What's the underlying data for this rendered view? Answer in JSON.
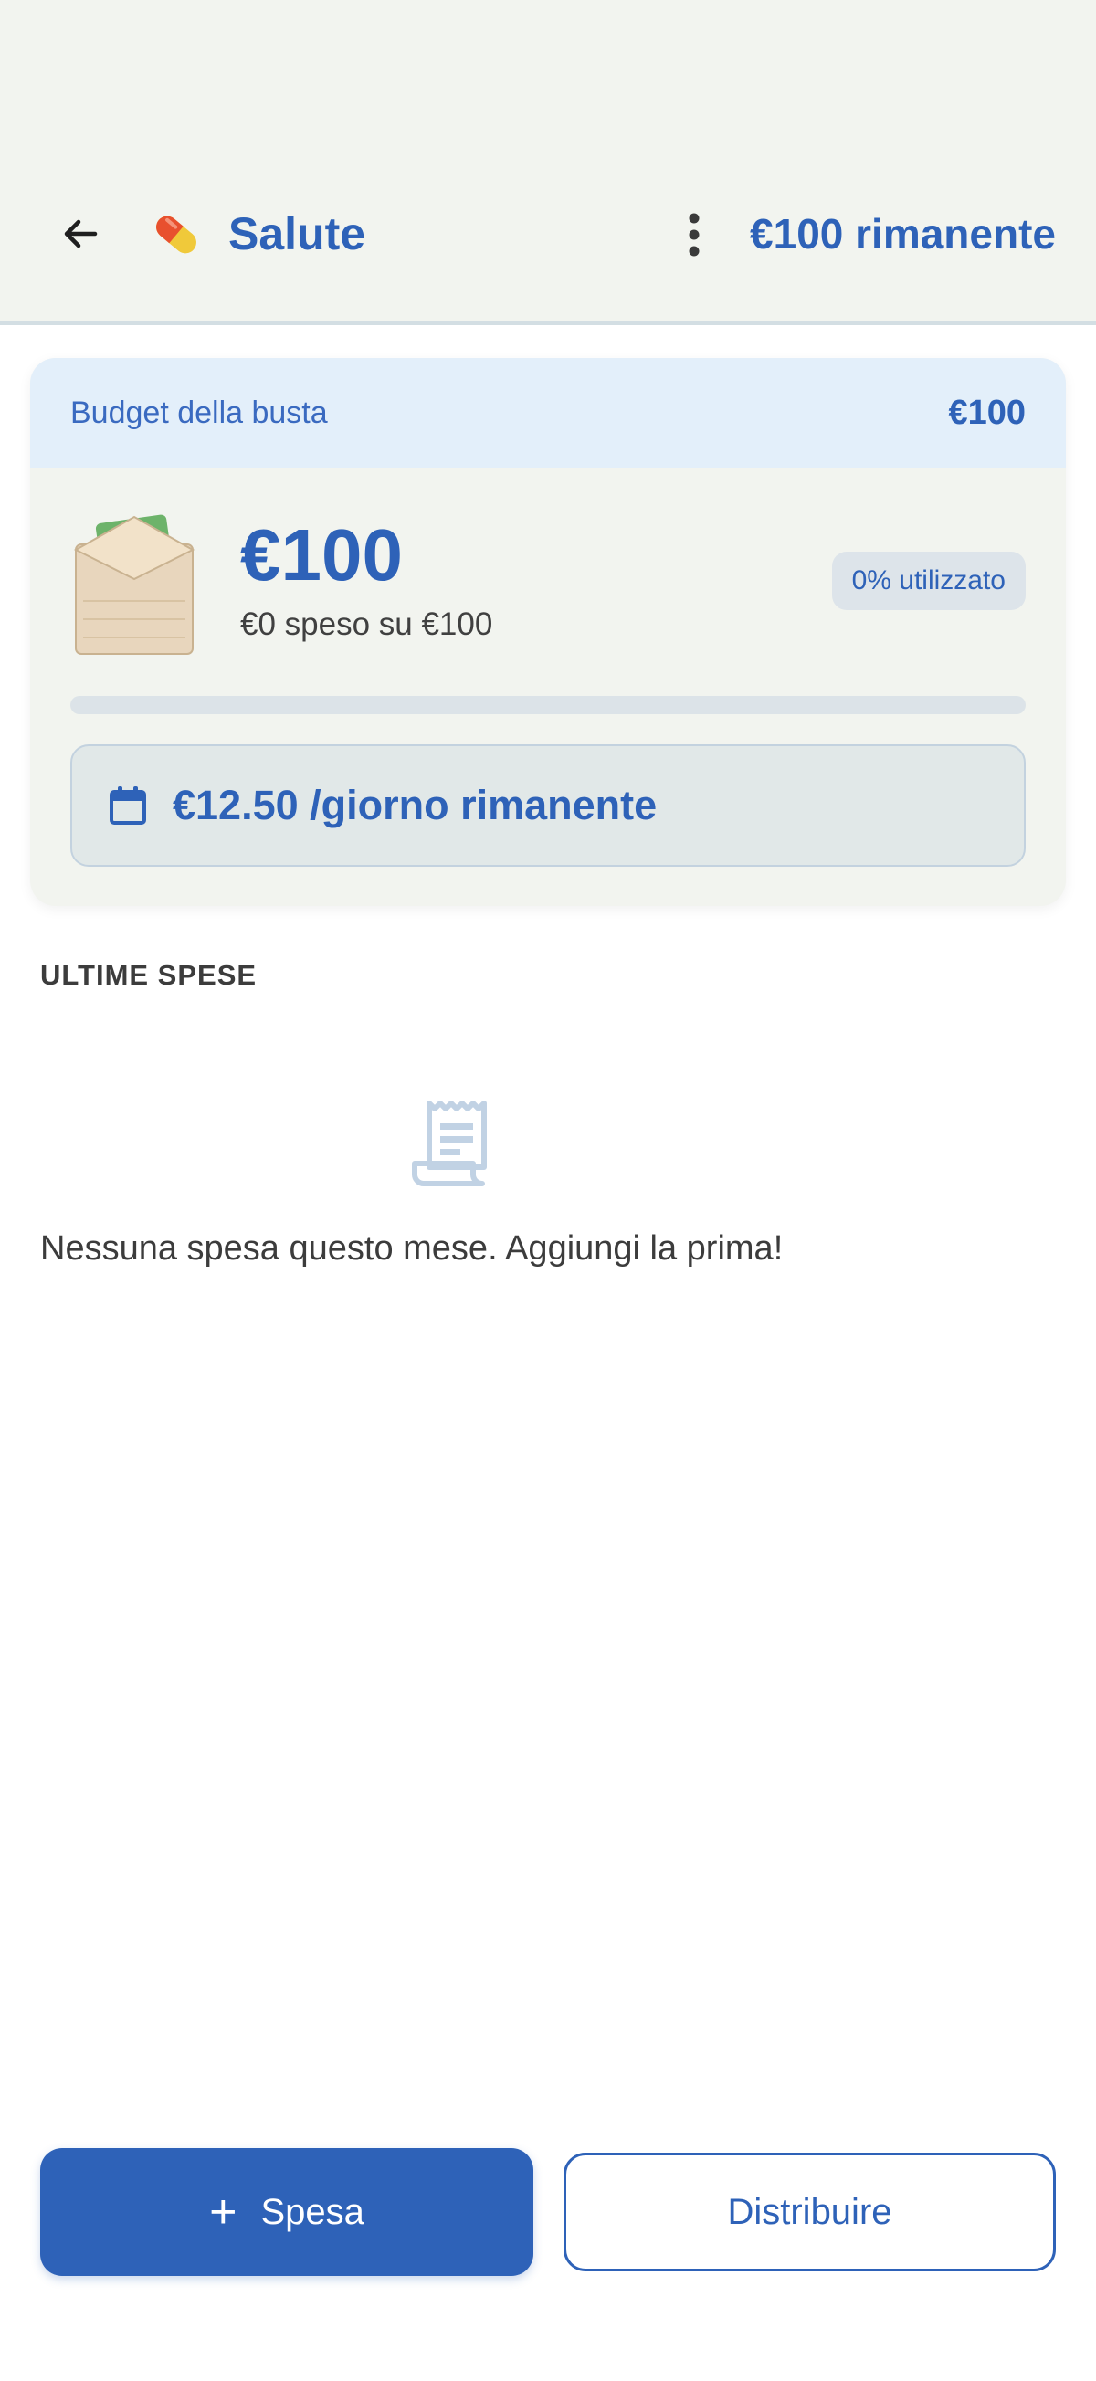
{
  "header": {
    "title": "Salute",
    "emoji_icon": "pill-icon",
    "remaining": "€100 rimanente"
  },
  "budget_card": {
    "label": "Budget della busta",
    "value": "€100",
    "amount": "€100",
    "spent_text": "€0 speso su €100",
    "used_badge": "0% utilizzato",
    "progress_fraction": 0,
    "daily_text": "€12.50 /giorno rimanente"
  },
  "recent": {
    "section_title": "ULTIME SPESE",
    "empty_message": "Nessuna spesa questo mese. Aggiungi la prima!"
  },
  "actions": {
    "add_plus": "+",
    "add_label": "Spesa",
    "distribute_label": "Distribuire"
  },
  "colors": {
    "accent": "#2e62b8",
    "header_bg": "#f2f4ef",
    "card_head_bg": "#e3effa"
  }
}
